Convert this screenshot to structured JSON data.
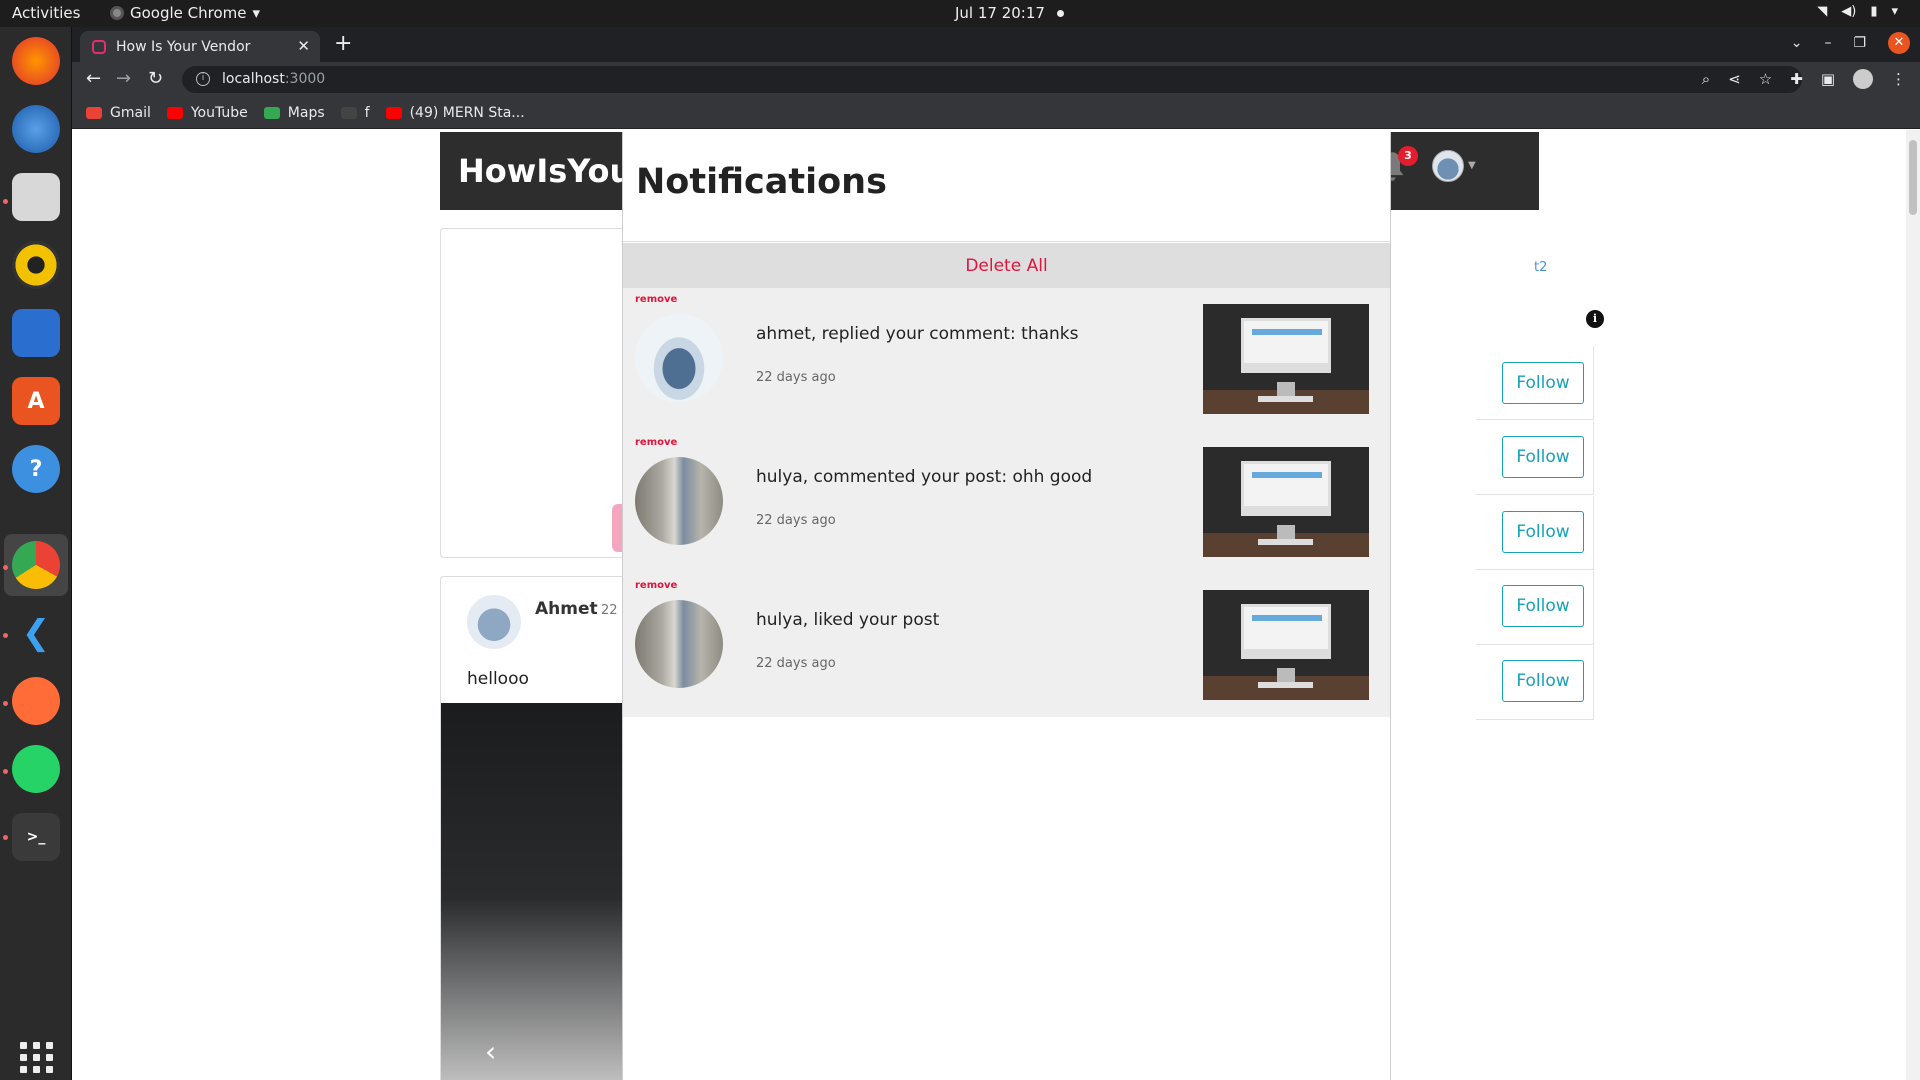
{
  "os": {
    "activities": "Activities",
    "app_name": "Google Chrome",
    "clock": "Jul 17  20:17"
  },
  "browser": {
    "tab_title": "How Is Your Vendor",
    "url_host": "localhost",
    "url_port": ":3000",
    "bookmarks": [
      {
        "label": "Gmail",
        "color": "#ea4335"
      },
      {
        "label": "YouTube",
        "color": "#ff0000"
      },
      {
        "label": "Maps",
        "color": "#34a853"
      },
      {
        "label": "f",
        "color": "#444444"
      },
      {
        "label": "(49) MERN Sta...",
        "color": "#ff0000"
      }
    ]
  },
  "app": {
    "brand": "HowIsYour",
    "notification_count": "3"
  },
  "post": {
    "author": "Ahmet",
    "date": "22",
    "text": "hellooo"
  },
  "sidebar": {
    "link_fragment": "t2",
    "follow_label": "Follow"
  },
  "notifications": {
    "title": "Notifications",
    "delete_all": "Delete All",
    "remove_label": "remove",
    "items": [
      {
        "text": "ahmet, replied your comment: thanks",
        "time": "22 days ago",
        "avatar": "snow"
      },
      {
        "text": "hulya, commented your post: ohh good",
        "time": "22 days ago",
        "avatar": "person"
      },
      {
        "text": "hulya, liked your post",
        "time": "22 days ago",
        "avatar": "person"
      }
    ]
  },
  "colors": {
    "accent_red": "#e0143c",
    "follow_teal": "#17a2b8",
    "navbar": "#2d2d2d"
  }
}
